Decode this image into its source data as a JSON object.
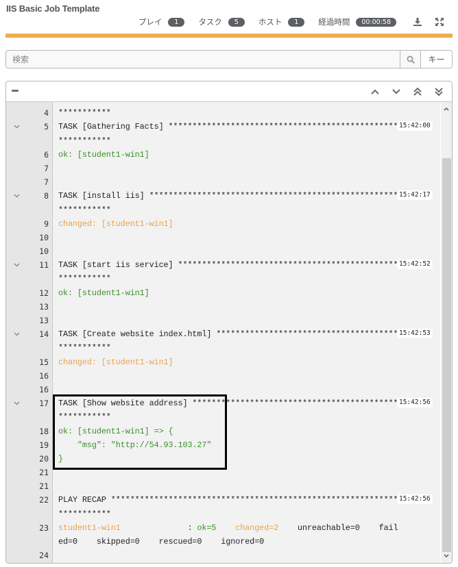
{
  "header": {
    "title": "IIS Basic Job Template",
    "stats": [
      {
        "label": "プレイ",
        "value": "1"
      },
      {
        "label": "タスク",
        "value": "5"
      },
      {
        "label": "ホスト",
        "value": "1"
      }
    ],
    "elapsed_label": "経過時間",
    "elapsed_value": "00:00:58",
    "icons": [
      "download-icon",
      "fullscreen-icon"
    ],
    "accent_color": "#f0ad4e"
  },
  "search": {
    "placeholder": "検索",
    "value": "",
    "key_button_label": "キー"
  },
  "log": {
    "top_partial": "***********",
    "lines": [
      {
        "num": "4",
        "segments": [],
        "fold": false
      },
      {
        "num": "5",
        "fold": true,
        "segments": [
          {
            "cls": "plain",
            "text": "TASK [Gathering Facts] ************************************************"
          }
        ],
        "ts": "15:42:00"
      },
      {
        "num": "",
        "fold": false,
        "segments": [
          {
            "cls": "plain",
            "text": "***********"
          }
        ]
      },
      {
        "num": "6",
        "fold": false,
        "segments": [
          {
            "cls": "ok",
            "text": "ok: [student1-win1]"
          }
        ]
      },
      {
        "num": "7",
        "fold": false,
        "segments": []
      },
      {
        "num": "7",
        "fold": false,
        "segments": []
      },
      {
        "num": "8",
        "fold": true,
        "segments": [
          {
            "cls": "plain",
            "text": "TASK [install iis] ****************************************************"
          }
        ],
        "ts": "15:42:17"
      },
      {
        "num": "",
        "fold": false,
        "segments": [
          {
            "cls": "plain",
            "text": "***********"
          }
        ]
      },
      {
        "num": "9",
        "fold": false,
        "segments": [
          {
            "cls": "changed",
            "text": "changed: [student1-win1]"
          }
        ]
      },
      {
        "num": "10",
        "fold": false,
        "segments": []
      },
      {
        "num": "10",
        "fold": false,
        "segments": []
      },
      {
        "num": "11",
        "fold": true,
        "segments": [
          {
            "cls": "plain",
            "text": "TASK [start iis service] **********************************************"
          }
        ],
        "ts": "15:42:52"
      },
      {
        "num": "",
        "fold": false,
        "segments": [
          {
            "cls": "plain",
            "text": "***********"
          }
        ]
      },
      {
        "num": "12",
        "fold": false,
        "segments": [
          {
            "cls": "ok",
            "text": "ok: [student1-win1]"
          }
        ]
      },
      {
        "num": "13",
        "fold": false,
        "segments": []
      },
      {
        "num": "13",
        "fold": false,
        "segments": []
      },
      {
        "num": "14",
        "fold": true,
        "segments": [
          {
            "cls": "plain",
            "text": "TASK [Create website index.html] **************************************"
          }
        ],
        "ts": "15:42:53"
      },
      {
        "num": "",
        "fold": false,
        "segments": [
          {
            "cls": "plain",
            "text": "***********"
          }
        ]
      },
      {
        "num": "15",
        "fold": false,
        "segments": [
          {
            "cls": "changed",
            "text": "changed: [student1-win1]"
          }
        ]
      },
      {
        "num": "16",
        "fold": false,
        "segments": []
      },
      {
        "num": "16",
        "fold": false,
        "segments": []
      },
      {
        "num": "17",
        "fold": true,
        "segments": [
          {
            "cls": "plain",
            "text": "TASK [Show website address] *******************************************"
          }
        ],
        "ts": "15:42:56"
      },
      {
        "num": "",
        "fold": false,
        "segments": [
          {
            "cls": "plain",
            "text": "***********"
          }
        ]
      },
      {
        "num": "18",
        "fold": false,
        "segments": [
          {
            "cls": "ok",
            "text": "ok: [student1-win1] => {"
          }
        ]
      },
      {
        "num": "19",
        "fold": false,
        "segments": [
          {
            "cls": "ok",
            "text": "    \"msg\": \"http://54.93.103.27\""
          }
        ]
      },
      {
        "num": "20",
        "fold": false,
        "segments": [
          {
            "cls": "ok",
            "text": "}"
          }
        ]
      },
      {
        "num": "21",
        "fold": false,
        "segments": []
      },
      {
        "num": "21",
        "fold": false,
        "segments": []
      },
      {
        "num": "22",
        "fold": false,
        "segments": [
          {
            "cls": "plain",
            "text": "PLAY RECAP ************************************************************"
          }
        ],
        "ts": "15:42:56"
      },
      {
        "num": "",
        "fold": false,
        "segments": [
          {
            "cls": "plain",
            "text": "***********"
          }
        ]
      },
      {
        "num": "23",
        "fold": false,
        "segments": [
          {
            "cls": "changed",
            "text": "student1-win1"
          },
          {
            "cls": "plain",
            "text": "              : "
          },
          {
            "cls": "ok",
            "text": "ok=5"
          },
          {
            "cls": "plain",
            "text": "    "
          },
          {
            "cls": "changed",
            "text": "changed=2"
          },
          {
            "cls": "plain",
            "text": "    unreachable=0    fail"
          }
        ]
      },
      {
        "num": "",
        "fold": false,
        "segments": [
          {
            "cls": "plain",
            "text": "ed=0    skipped=0    rescued=0    ignored=0"
          }
        ]
      },
      {
        "num": "24",
        "fold": false,
        "segments": []
      }
    ]
  },
  "colors": {
    "ok": "#3c8f2a",
    "changed": "#e8a34e",
    "badge": "#5c5f63"
  },
  "scroll": {
    "position_fraction": 0.13
  }
}
